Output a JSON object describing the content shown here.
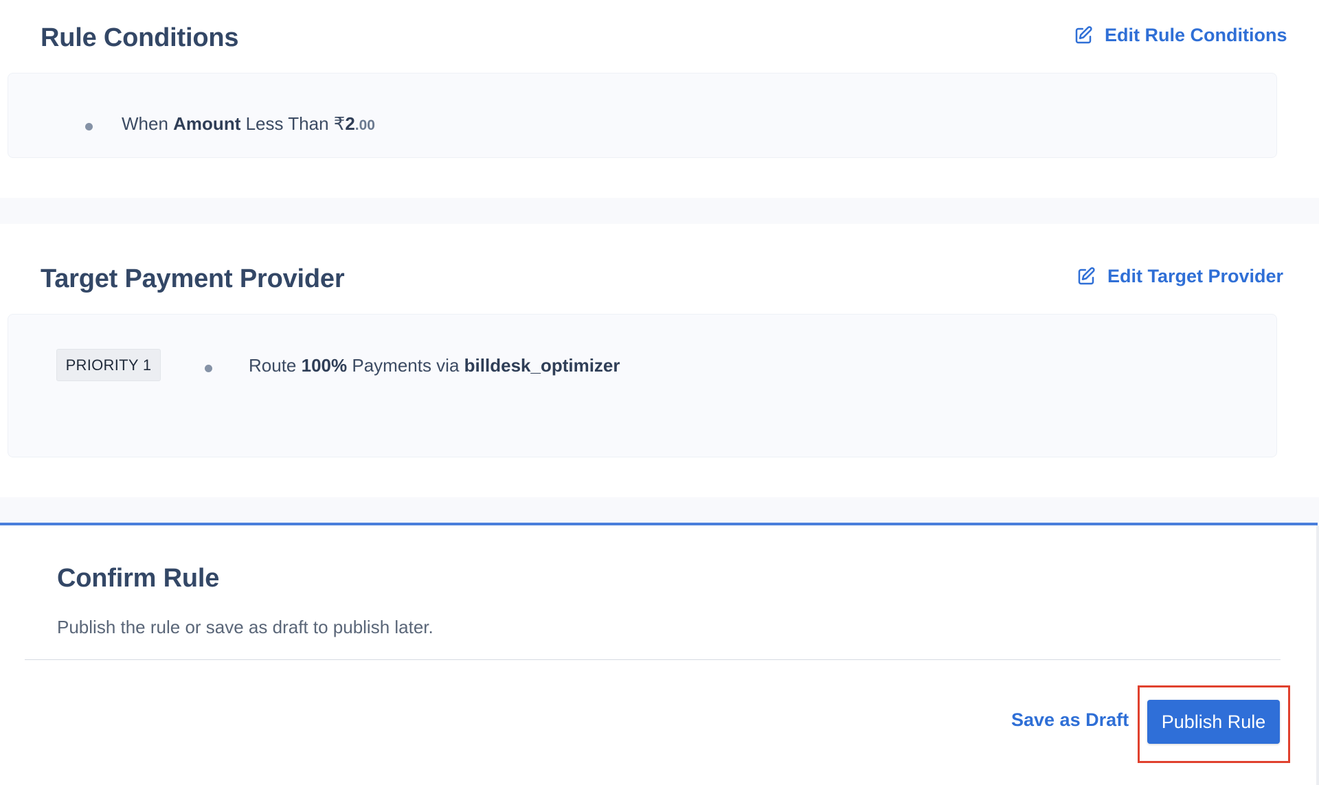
{
  "rule_conditions": {
    "title": "Rule Conditions",
    "edit_label": "Edit Rule Conditions",
    "condition": {
      "prefix": "When",
      "field": "Amount",
      "operator": "Less Than",
      "currency": "₹",
      "value_int": "2",
      "value_dec": ".00"
    }
  },
  "target_provider": {
    "title": "Target Payment Provider",
    "edit_label": "Edit Target Provider",
    "priority_badge": "PRIORITY 1",
    "route": {
      "prefix": "Route",
      "percent": "100%",
      "middle": "Payments via",
      "provider": "billdesk_optimizer"
    }
  },
  "confirm": {
    "title": "Confirm Rule",
    "description": "Publish the rule or save as draft to publish later.",
    "save_draft_label": "Save as Draft",
    "publish_label": "Publish Rule"
  },
  "colors": {
    "accent": "#2f6fd6",
    "highlight": "#e0412e"
  },
  "icons": {
    "edit": "edit-icon"
  }
}
